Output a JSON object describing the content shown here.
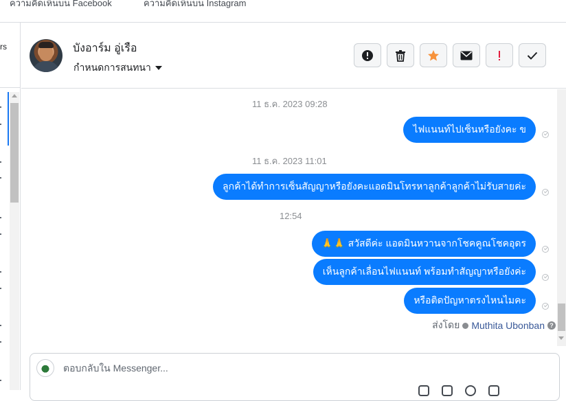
{
  "top_tabs": {
    "facebook_comments": "ความคิดเห็นบน Facebook",
    "instagram_comments": "ความคิดเห็นบน Instagram"
  },
  "left_panel": {
    "cut_text": "rs"
  },
  "header": {
    "contact_name": "บังอาร์ม อู่เรือ",
    "assign_label": "กำหนดการสนทนา",
    "actions": [
      "spam-icon",
      "trash-icon",
      "star-icon",
      "mark-unread-icon",
      "follow-up-icon",
      "done-icon"
    ]
  },
  "thread": {
    "timestamps": [
      "11 ธ.ค. 2023 09:28",
      "11 ธ.ค. 2023 11:01",
      "12:54"
    ],
    "messages": [
      "ไฟแนนท์ไปเซ็นหรือยังคะ ข",
      "ลูกค้าได้ทำการเซ็นสัญญาหรือยังคะแอดมินโทรหาลูกค้าลูกค้าไม่รับสายค่ะ",
      "🙏🙏 สวัสดีค่ะ แอดมินหวานจากโชคคูณโชคอุดร",
      "เห็นลูกค้าเลื่อนไฟแนนท์ พร้อมทำสัญญาหรือยังค่ะ",
      "หรือติดปัญหาตรงไหนไมคะ"
    ],
    "sent_by_label": "ส่งโดย",
    "sent_by_name": "Muthita Ubonban",
    "help": "?"
  },
  "composer": {
    "placeholder": "ตอบกลับใน Messenger..."
  },
  "colors": {
    "bubble": "#0a7cff",
    "star": "#f7923b",
    "alert": "#e41e3f"
  }
}
